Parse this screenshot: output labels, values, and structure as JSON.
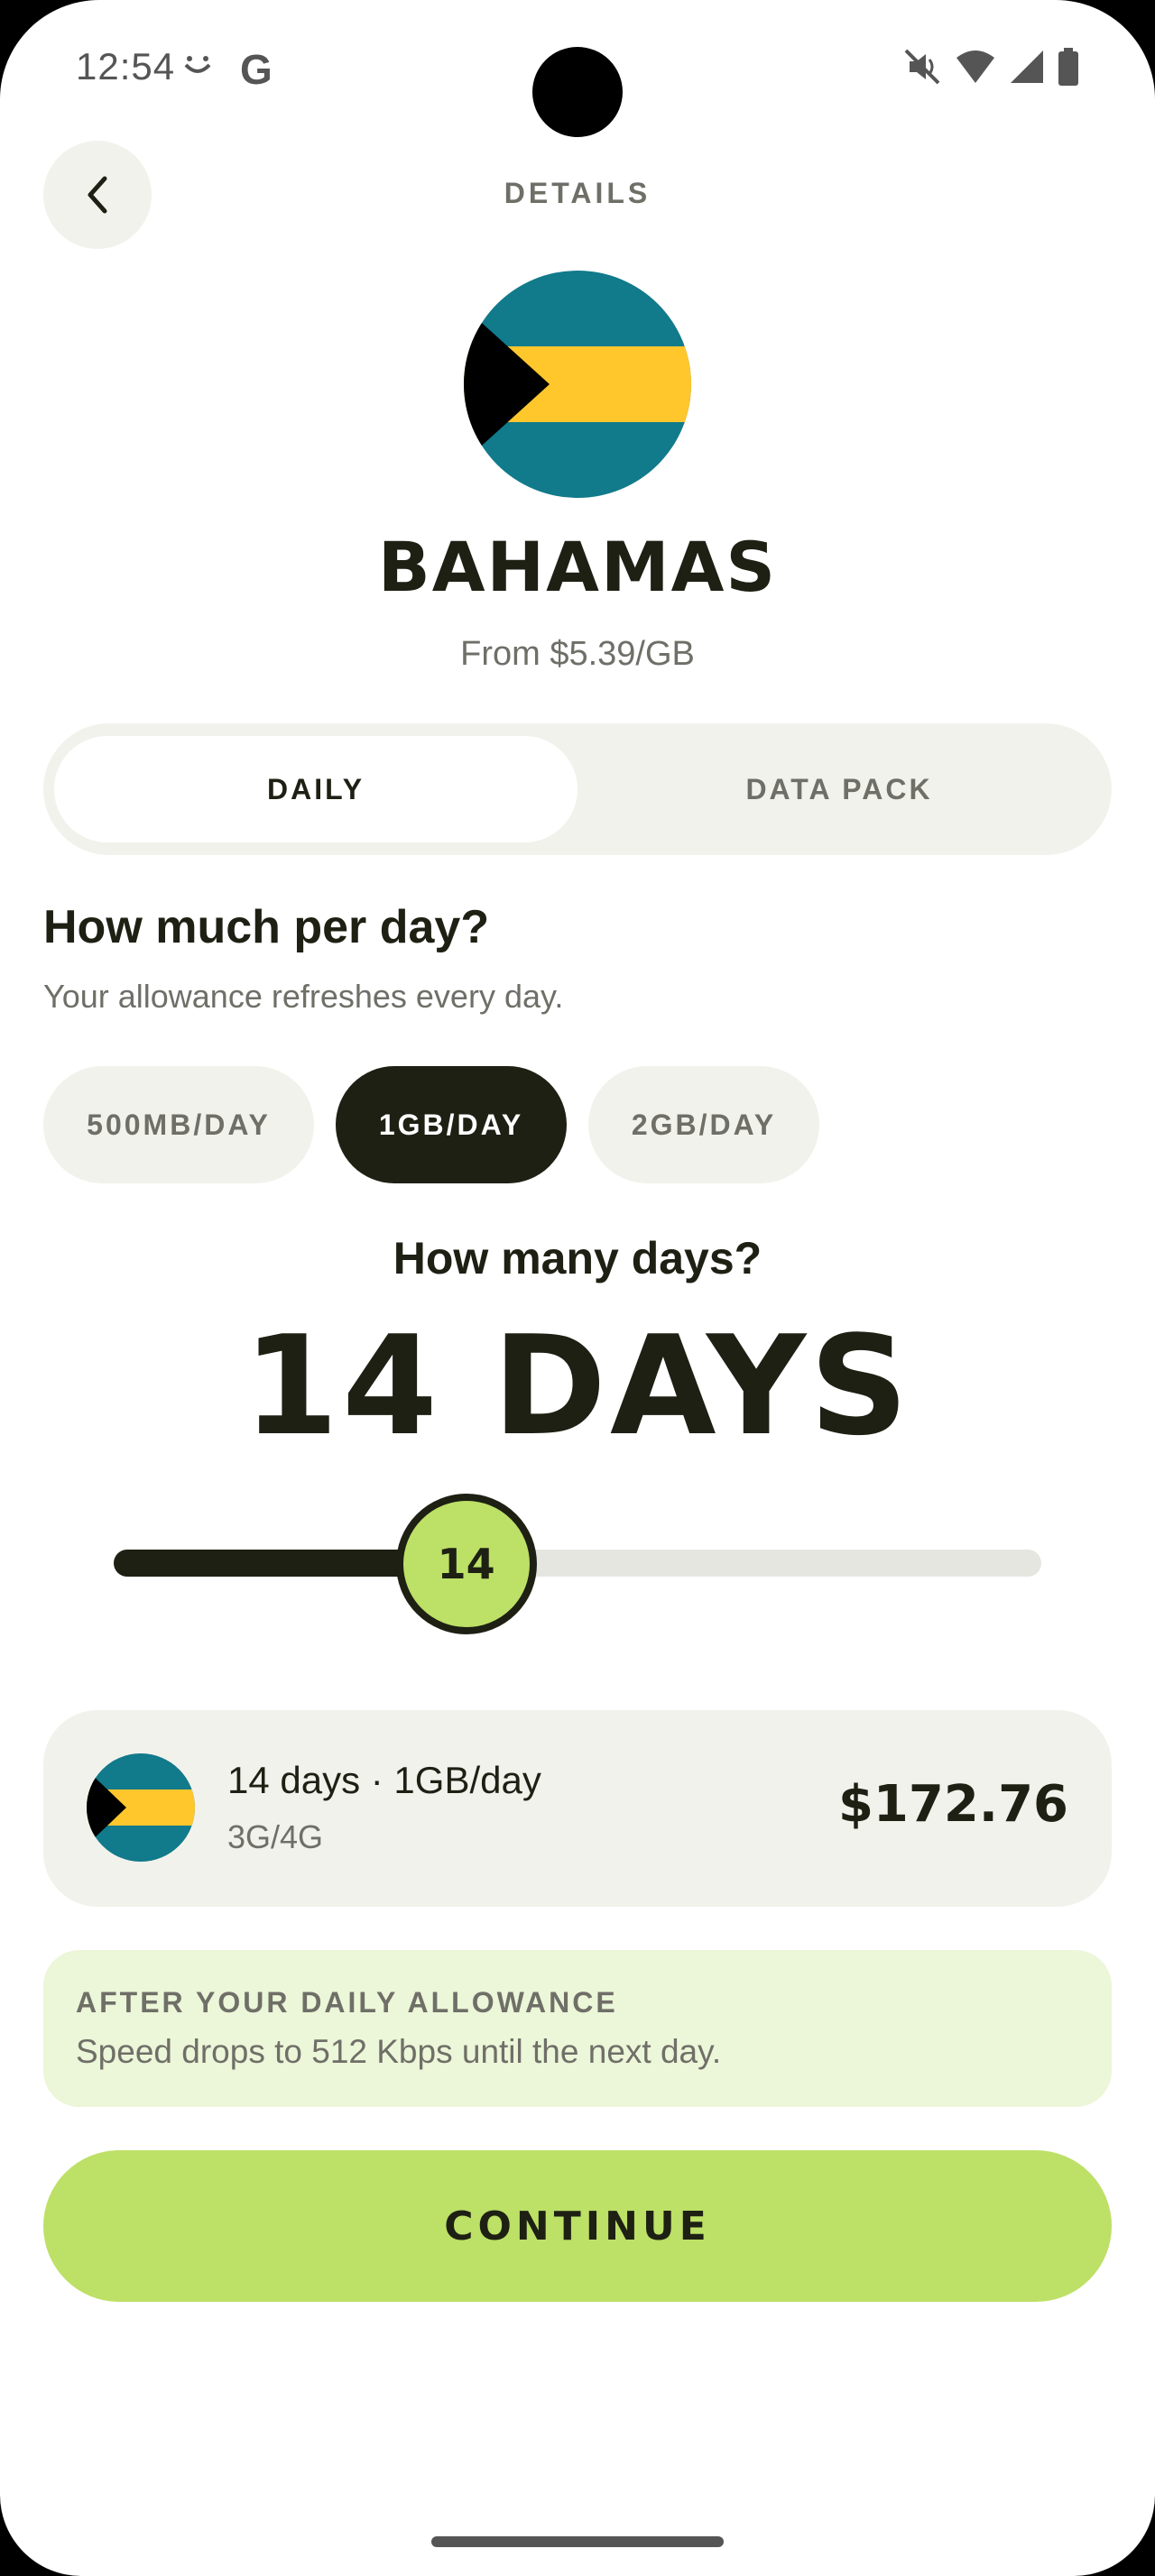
{
  "status_bar": {
    "time": "12:54",
    "google_glyph": "G",
    "icons": [
      "smile-icon",
      "google-icon",
      "mute-icon",
      "wifi-icon",
      "signal-icon",
      "battery-icon"
    ]
  },
  "header": {
    "title": "DETAILS",
    "back_icon": "chevron-left-icon"
  },
  "country": {
    "name": "BAHAMAS",
    "price_from": "From $5.39/GB",
    "flag": {
      "blue": "#117a8b",
      "yellow": "#ffc72c",
      "black": "#000000"
    }
  },
  "tabs": [
    {
      "label": "DAILY",
      "active": true
    },
    {
      "label": "DATA PACK",
      "active": false
    }
  ],
  "allowance": {
    "title": "How much per day?",
    "subtitle": "Your allowance refreshes every day.",
    "options": [
      {
        "label": "500MB/DAY",
        "selected": false
      },
      {
        "label": "1GB/DAY",
        "selected": true
      },
      {
        "label": "2GB/DAY",
        "selected": false
      }
    ]
  },
  "days": {
    "title": "How many days?",
    "value_label": "14 DAYS",
    "slider_value": "14",
    "slider_fraction": 0.38
  },
  "summary": {
    "plan": "14 days · 1GB/day",
    "network": "3G/4G",
    "price": "$172.76"
  },
  "info": {
    "title": "AFTER YOUR DAILY ALLOWANCE",
    "text": "Speed drops to 512 Kbps until the next day."
  },
  "continue_label": "CONTINUE",
  "colors": {
    "accent_green": "#bde066",
    "dark": "#1d2013",
    "muted": "#6f6f68",
    "surface": "#f2f2ec",
    "info_bg": "#ecf6d8"
  }
}
